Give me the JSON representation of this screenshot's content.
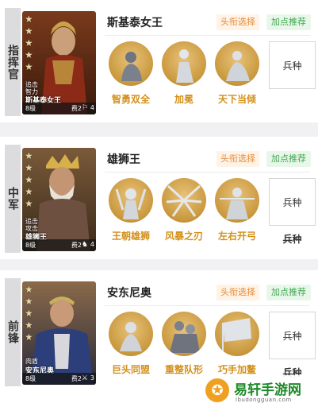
{
  "heroes": [
    {
      "role": "指挥官",
      "name": "斯基泰女王",
      "portrait_attr": [
        "追击",
        "智力"
      ],
      "portrait_name": "斯基泰女王",
      "level": "8级",
      "cost": "费2",
      "unit_count": "4",
      "title_btn": "头衔选择",
      "points_btn": "加点推荐",
      "skills": [
        "智勇双全",
        "加冕",
        "天下当倾"
      ],
      "troop_box": "兵种",
      "troop_label": ""
    },
    {
      "role": "中军",
      "name": "雄狮王",
      "portrait_attr": [
        "追击",
        "攻击"
      ],
      "portrait_name": "雄狮王",
      "level": "8级",
      "cost": "费2",
      "unit_count": "4",
      "title_btn": "头衔选择",
      "points_btn": "加点推荐",
      "skills": [
        "王朝雄狮",
        "风暴之刃",
        "左右开弓"
      ],
      "troop_box": "兵种",
      "troop_label": "兵种"
    },
    {
      "role": "前锋",
      "name": "安东尼奥",
      "portrait_attr": [
        "肉盾"
      ],
      "portrait_name": "安东尼奥",
      "level": "8级",
      "cost": "费2",
      "unit_count": "3",
      "title_btn": "头衔选择",
      "points_btn": "加点推荐",
      "skills": [
        "巨头同盟",
        "重整队形",
        "巧手加鳌"
      ],
      "troop_box": "兵种",
      "troop_label": "兵种"
    }
  ],
  "watermark": {
    "logo_char": "✪",
    "title": "易轩手游网",
    "sub": "ibudongguan.com"
  }
}
